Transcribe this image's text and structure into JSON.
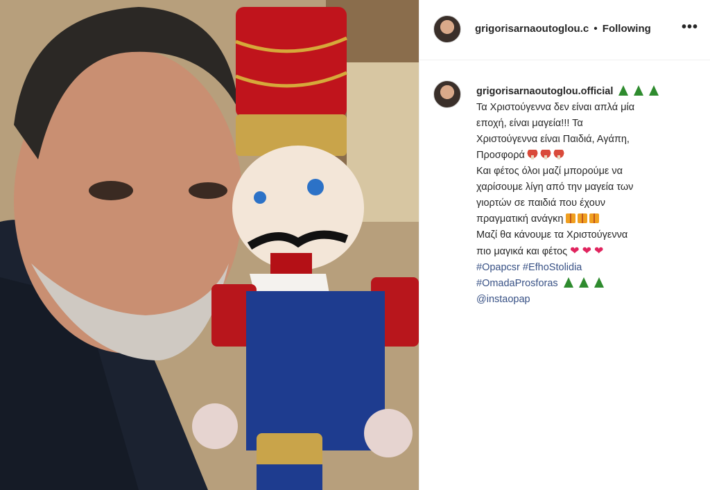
{
  "post": {
    "username": "grigorisarnaoutoglou.c",
    "separator": "•",
    "follow_status": "Following",
    "more_label": "•••"
  },
  "caption": {
    "username": "grigorisarnaoutoglou.official",
    "lines": [
      "Τα Χριστούγεννα δεν είναι απλά μία",
      "εποχή, είναι μαγεία!!! Τα",
      "Χριστούγεννα είναι Παιδιά, Αγάπη,",
      "Προσφορά",
      "Και φέτος όλοι μαζί μπορούμε να",
      "χαρίσουμε λίγη από την μαγεία των",
      "γιορτών σε παιδιά που έχουν",
      "πραγματική ανάγκη",
      "Μαζί θα κάνουμε τα Χριστούγεννα",
      "πιο μαγικά και φέτος"
    ],
    "hashtags": [
      "#Opapcsr",
      "#EfhoStolidia",
      "#OmadaProsforas"
    ],
    "mention": "@instaopap",
    "hearts": [
      "❤",
      "❤",
      "❤"
    ]
  },
  "icons": {
    "tree": "christmas-tree-icon",
    "mushroom": "mushroom-icon",
    "gift": "gift-icon",
    "heart": "red-heart-icon"
  },
  "colors": {
    "link": "#385185",
    "text": "#262626",
    "tree": "#2e8b2e",
    "heart": "#e0245e"
  }
}
